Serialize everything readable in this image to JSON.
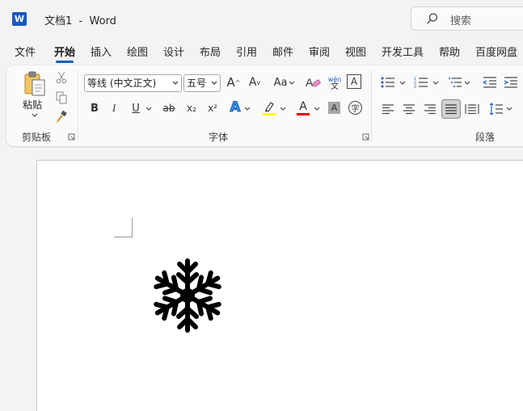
{
  "titlebar": {
    "app_icon_letter": "W",
    "document_title": "文档1  -  Word",
    "search_placeholder": "搜索"
  },
  "tabs": [
    {
      "label": "文件",
      "active": false
    },
    {
      "label": "开始",
      "active": true
    },
    {
      "label": "插入",
      "active": false
    },
    {
      "label": "绘图",
      "active": false
    },
    {
      "label": "设计",
      "active": false
    },
    {
      "label": "布局",
      "active": false
    },
    {
      "label": "引用",
      "active": false
    },
    {
      "label": "邮件",
      "active": false
    },
    {
      "label": "审阅",
      "active": false
    },
    {
      "label": "视图",
      "active": false
    },
    {
      "label": "开发工具",
      "active": false
    },
    {
      "label": "帮助",
      "active": false
    },
    {
      "label": "百度网盘",
      "active": false
    }
  ],
  "ribbon": {
    "clipboard": {
      "paste_label": "粘贴",
      "group_label": "剪贴板"
    },
    "font": {
      "font_name": "等线 (中文正文)",
      "font_size": "五号",
      "group_label": "字体",
      "bold": "B",
      "italic": "I",
      "underline": "U",
      "strikethrough": "ab",
      "subscript": "x₂",
      "superscript": "x²",
      "text_effects": "A",
      "font_color_letter": "A",
      "shading_letter": "A",
      "change_case": "Aa",
      "grow_font": "A",
      "shrink_font": "A",
      "phonetic_top": "wén",
      "phonetic_bottom": "文",
      "char_border": "A",
      "enclose_char": "字"
    },
    "paragraph": {
      "group_label": "段落"
    }
  },
  "colors": {
    "accent": "#185abd",
    "highlight": "#ffff00",
    "font_color": "#e00000"
  },
  "document": {
    "content_icon": "snowflake-icon"
  }
}
